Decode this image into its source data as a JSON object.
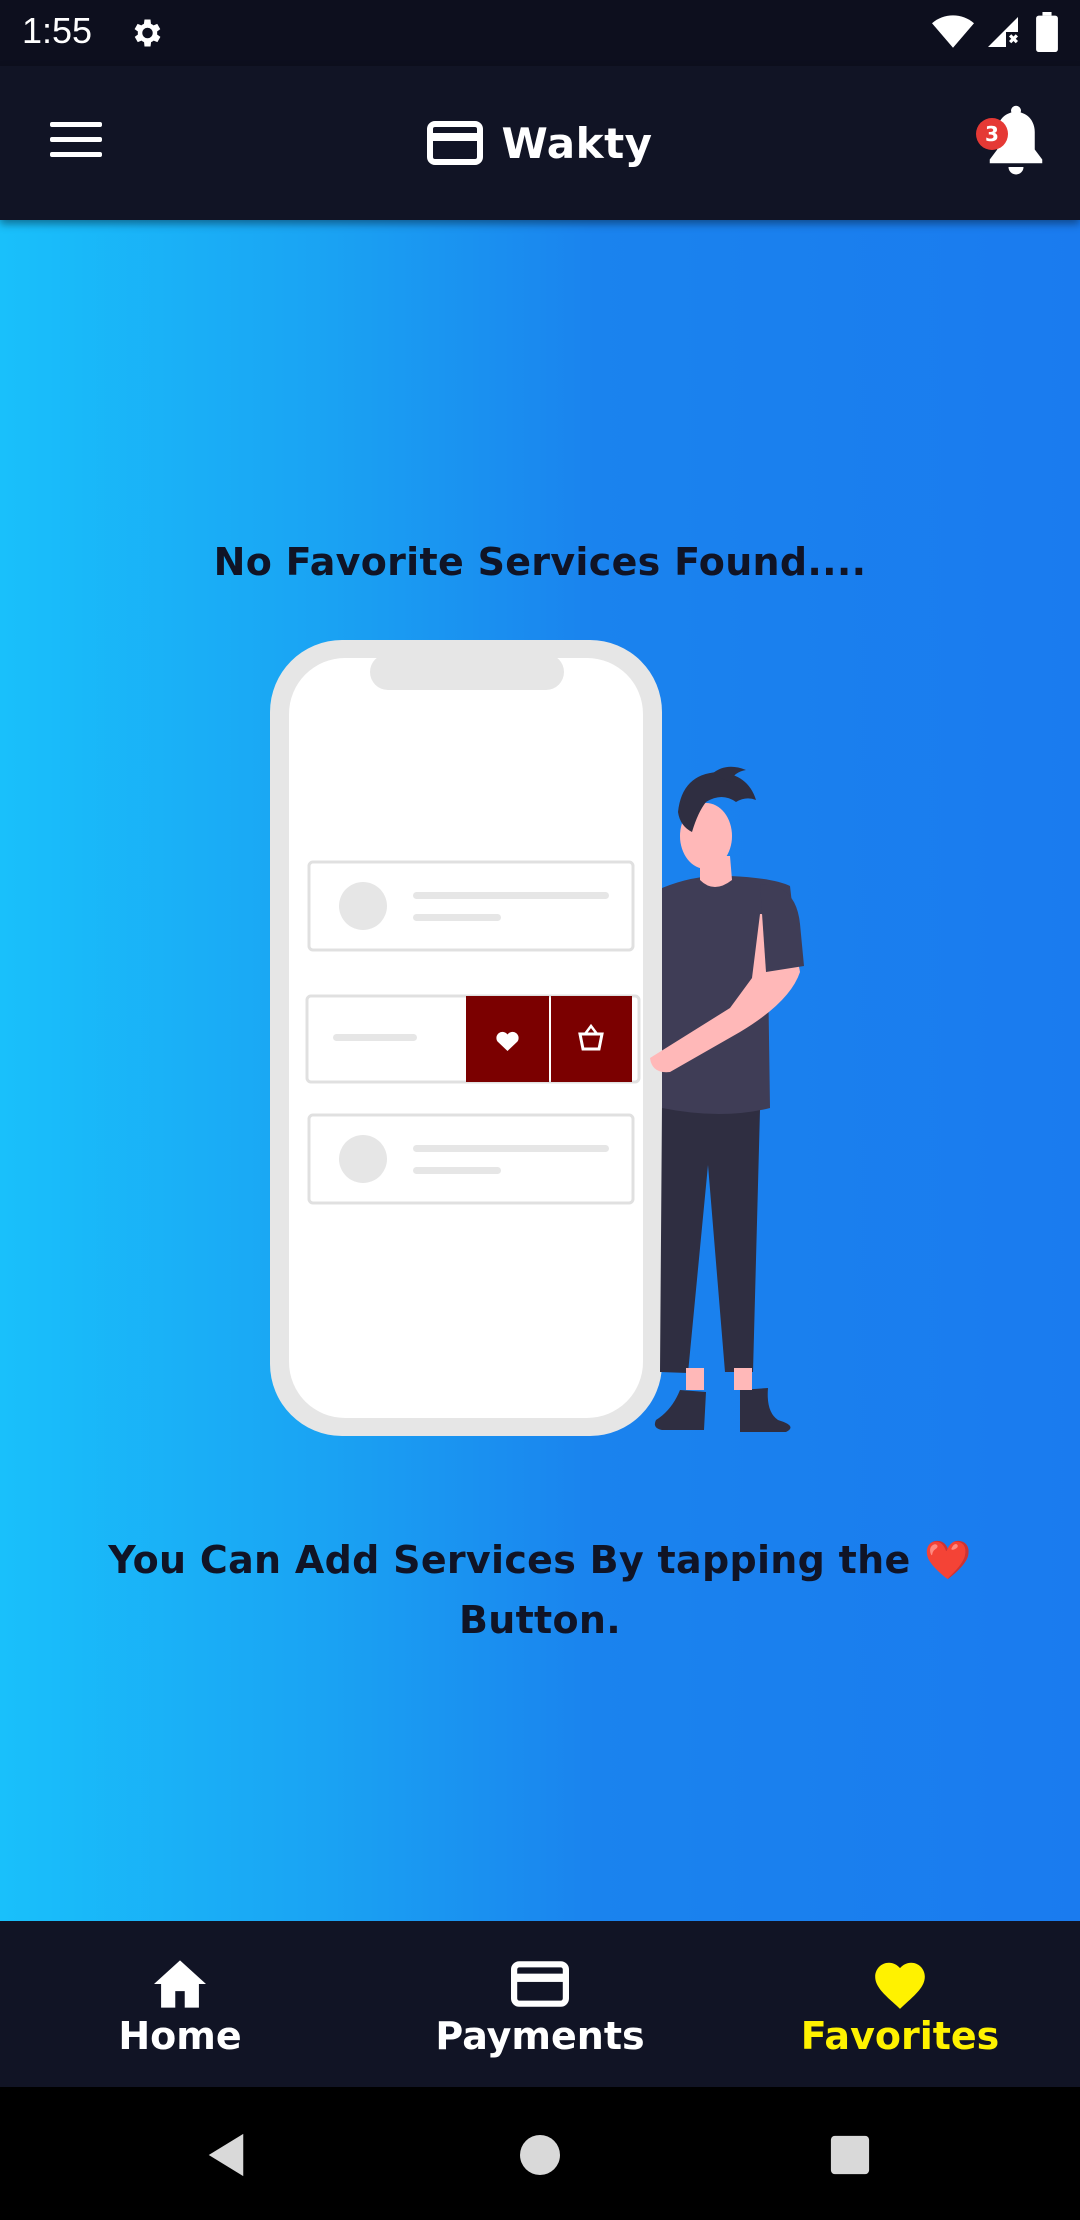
{
  "status_bar": {
    "time": "1:55",
    "icons": [
      "settings-gear-icon",
      "wifi-icon",
      "cellular-signal-icon",
      "battery-icon"
    ]
  },
  "app_bar": {
    "title": "Wakty",
    "logo_icon": "credit-card-icon",
    "menu_icon": "hamburger-menu-icon",
    "notification_icon": "bell-icon",
    "notification_count": "3"
  },
  "main": {
    "empty_title": "No Favorite Services Found....",
    "empty_hint": "You Can Add Services By tapping the ❤️ Button.",
    "illustration": {
      "description_icon": "person-with-phone-illustration",
      "action_icons": [
        "heart-icon",
        "basket-icon"
      ],
      "accent_color": "#7b0000"
    }
  },
  "bottom_nav": {
    "items": [
      {
        "label": "Home",
        "icon": "home-icon",
        "active": false
      },
      {
        "label": "Payments",
        "icon": "credit-card-icon",
        "active": false
      },
      {
        "label": "Favorites",
        "icon": "heart-icon",
        "active": true
      }
    ]
  },
  "system_nav": {
    "icons": [
      "back-triangle-icon",
      "home-circle-icon",
      "recents-square-icon"
    ]
  },
  "colors": {
    "app_bar_bg": "#111425",
    "gradient_start": "#19c0fb",
    "gradient_end": "#1a7bef",
    "active_tab": "#fff200",
    "badge": "#e53935",
    "text_dark": "#101426"
  }
}
